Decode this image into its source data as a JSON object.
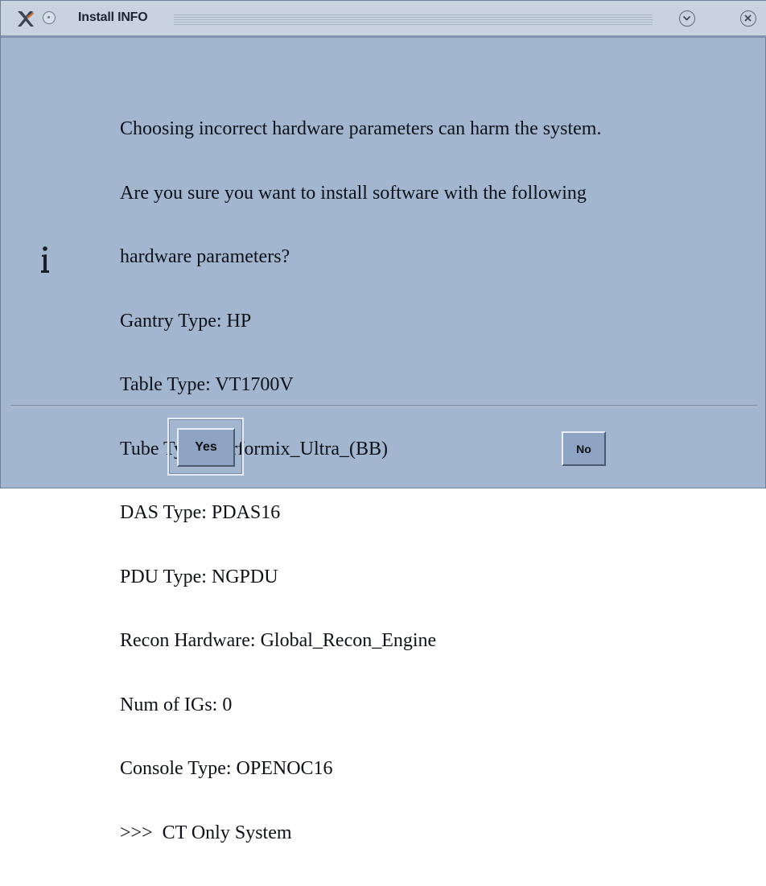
{
  "window": {
    "title": "Install INFO",
    "icons": {
      "app": "x-app-icon",
      "menu": "window-menu-icon",
      "minimize": "chevron-down-circle-icon",
      "close": "close-circle-icon"
    },
    "colors": {
      "background": "#a3b6cf",
      "titlebar": "#c9d3e0",
      "button": "#8ea4c4"
    }
  },
  "dialog": {
    "icon": "info-icon",
    "lines": [
      "Choosing incorrect hardware parameters can harm the system.",
      "Are you sure you want to install software with the following",
      "hardware parameters?",
      "Gantry Type: HP",
      "Table Type: VT1700V",
      "Tube Type: Performix_Ultra_(BB)",
      "DAS Type: PDAS16",
      "PDU Type: NGPDU",
      "Recon Hardware: Global_Recon_Engine",
      "Num of IGs: 0",
      "Console Type: OPENOC16",
      ">>>  CT Only System"
    ]
  },
  "buttons": {
    "yes_label": "Yes",
    "no_label": "No"
  }
}
